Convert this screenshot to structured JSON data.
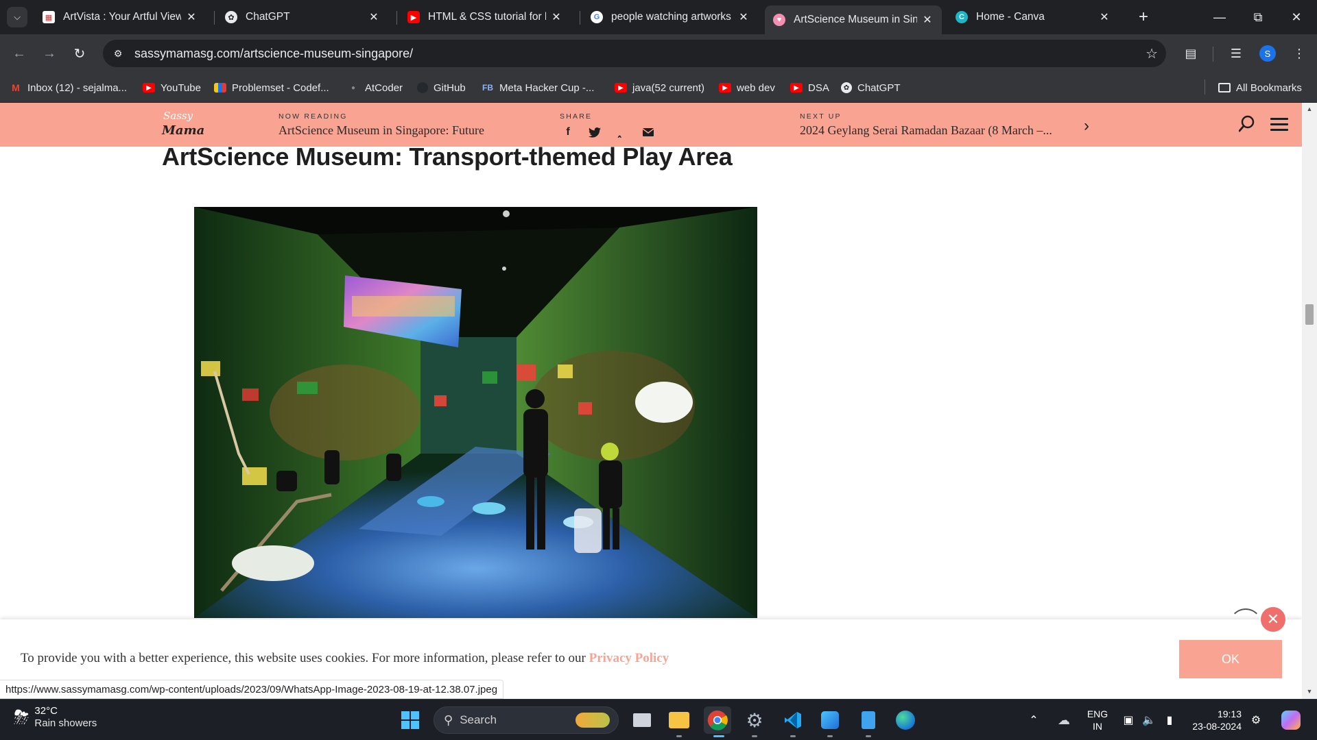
{
  "browser": {
    "tab_search_icon": "chevron-down-icon",
    "tabs": [
      {
        "title": "ArtVista : Your Artful Viewp",
        "favicon": "artvista-icon",
        "active": false
      },
      {
        "title": "ChatGPT",
        "favicon": "chatgpt-icon",
        "active": false
      },
      {
        "title": "HTML & CSS tutorial for be",
        "favicon": "youtube-icon",
        "active": false
      },
      {
        "title": "people watching artworks",
        "favicon": "google-icon",
        "active": false
      },
      {
        "title": "ArtScience Museum in Sing",
        "favicon": "sassymama-icon",
        "active": true
      },
      {
        "title": "Home - Canva",
        "favicon": "canva-icon",
        "active": false
      }
    ],
    "url_domain": "sassymamasg.com",
    "url_path": "/artscience-museum-singapore/",
    "profile_initial": "S",
    "bookmarks": [
      {
        "label": "Inbox (12) - sejalma...",
        "icon": "gmail-icon"
      },
      {
        "label": "YouTube",
        "icon": "youtube-icon"
      },
      {
        "label": "Problemset - Codef...",
        "icon": "codeforces-icon"
      },
      {
        "label": "AtCoder",
        "icon": "atcoder-icon"
      },
      {
        "label": "GitHub",
        "icon": "github-icon"
      },
      {
        "label": "Meta Hacker Cup -...",
        "icon": "facebook-icon"
      },
      {
        "label": "java(52 current)",
        "icon": "youtube-icon"
      },
      {
        "label": "web dev",
        "icon": "youtube-icon"
      },
      {
        "label": "DSA",
        "icon": "youtube-icon"
      },
      {
        "label": "ChatGPT",
        "icon": "chatgpt-icon"
      }
    ],
    "all_bookmarks_label": "All Bookmarks",
    "status_url": "https://www.sassymamasg.com/wp-content/uploads/2023/09/WhatsApp-Image-2023-08-19-at-12.38.07.jpeg"
  },
  "site": {
    "logo_line1": "Sassy",
    "logo_line2": "Mama",
    "now_reading_label": "NOW READING",
    "now_reading_title": "ArtScience Museum in Singapore: Future",
    "share_label": "SHARE",
    "share_icons": [
      "facebook-icon",
      "twitter-icon",
      "pinterest-icon",
      "email-icon"
    ],
    "next_up_label": "NEXT UP",
    "next_up_title": "2024 Geylang Serai Ramadan Bazaar (8 March –...",
    "accent_color": "#f9a493"
  },
  "article": {
    "heading": "ArtScience Museum: Transport-themed Play Area"
  },
  "cookie": {
    "text": "To provide you with a better experience, this website uses cookies. For more information, please refer to our ",
    "link_text": "Privacy Policy",
    "ok_label": "OK"
  },
  "taskbar": {
    "weather_temp": "32°C",
    "weather_condition": "Rain showers",
    "search_placeholder": "Search",
    "language_line1": "ENG",
    "language_line2": "IN",
    "time": "19:13",
    "date": "23-08-2024"
  }
}
